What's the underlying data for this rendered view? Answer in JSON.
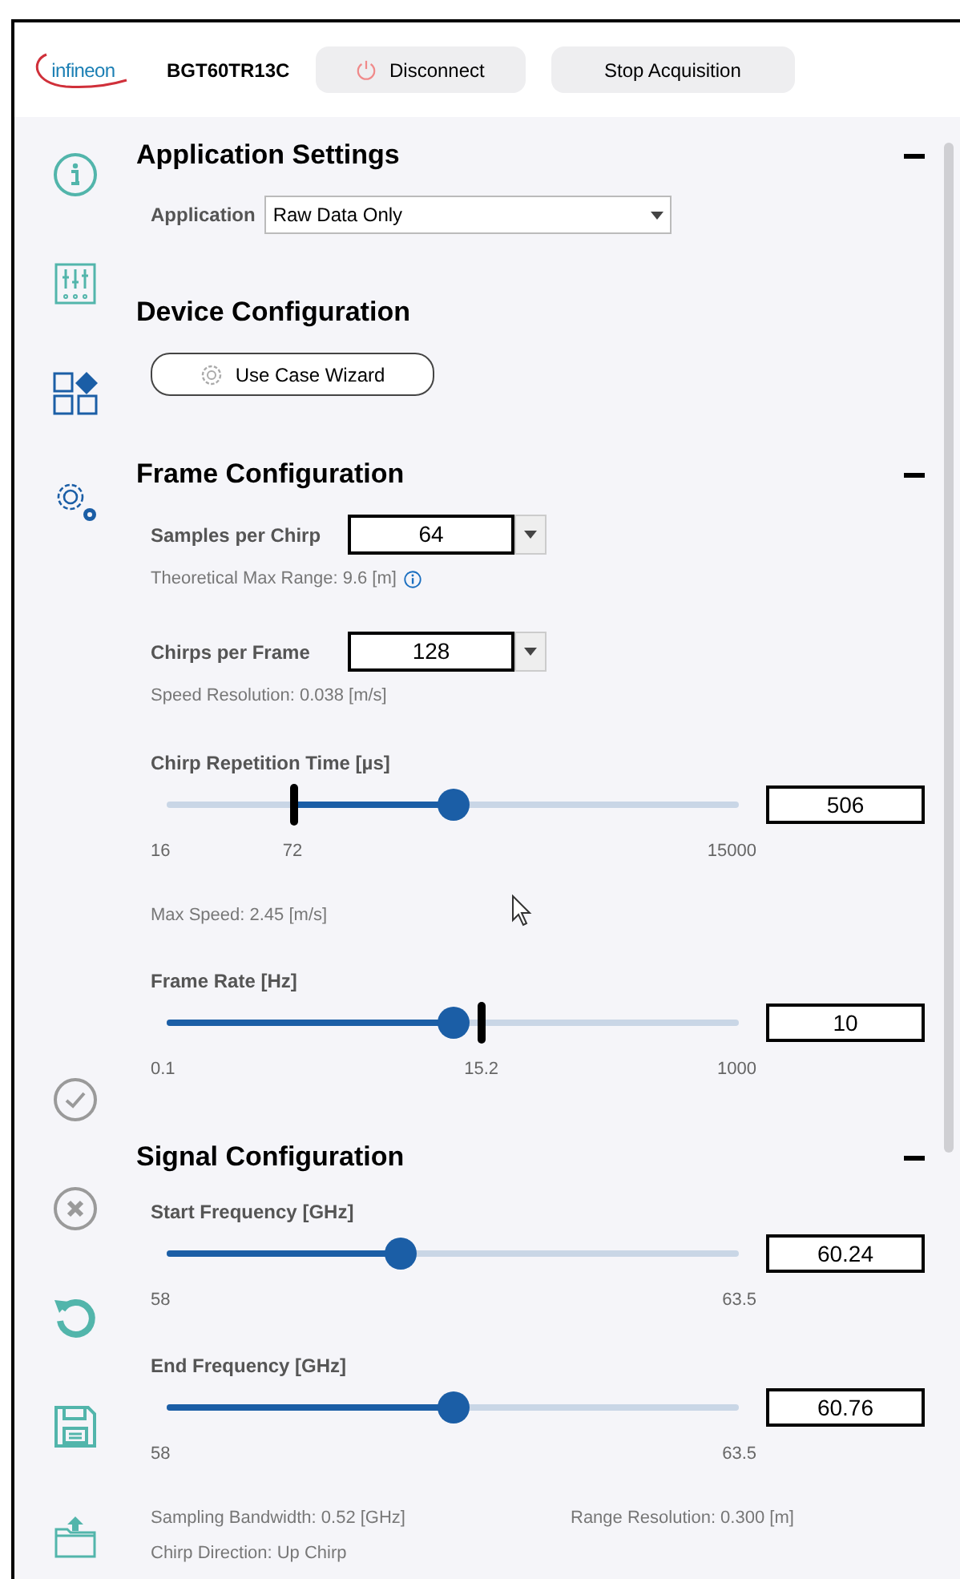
{
  "header": {
    "logo": "infineon",
    "device": "BGT60TR13C",
    "buttons": [
      {
        "kind": "power",
        "label": "Disconnect"
      },
      {
        "kind": "plain",
        "label": "Stop Acquisition"
      }
    ]
  },
  "sections": [
    {
      "title": "Application Settings",
      "collapsible": true,
      "items": [
        {
          "kind": "select",
          "label": "Application",
          "value": "Raw Data Only"
        }
      ]
    },
    {
      "title": "Device Configuration",
      "collapsible": false,
      "items": [
        {
          "kind": "button",
          "label": "Use Case Wizard"
        }
      ]
    },
    {
      "title": "Frame Configuration",
      "collapsible": true,
      "items": [
        {
          "kind": "spin",
          "label": "Samples per Chirp",
          "value": "64",
          "note": "Theoretical Max Range: 9.6 [m]",
          "info_icon": true
        },
        {
          "kind": "spin",
          "label": "Chirps per Frame",
          "value": "128",
          "note": "Speed Resolution: 0.038 [m/s]",
          "info_icon": false
        },
        {
          "kind": "slider",
          "label": "Chirp Repetition Time [µs]",
          "value": "506",
          "level": 0.5,
          "min": "16",
          "max": "15000",
          "marker": {
            "level": 0.22,
            "label": "72"
          }
        },
        {
          "kind": "note",
          "text": "Max Speed: 2.45 [m/s]"
        },
        {
          "kind": "slider",
          "label": "Frame Rate [Hz]",
          "value": "10",
          "level": 0.5,
          "min": "0.1",
          "max": "1000",
          "marker": {
            "level": 0.55,
            "label": "15.2"
          }
        }
      ]
    },
    {
      "title": "Signal Configuration",
      "collapsible": true,
      "items": [
        {
          "kind": "slider",
          "label": "Start Frequency [GHz]",
          "value": "60.24",
          "level": 0.41,
          "min": "58",
          "max": "63.5"
        },
        {
          "kind": "slider",
          "label": "End Frequency [GHz]",
          "value": "60.76",
          "level": 0.5,
          "min": "58",
          "max": "63.5"
        },
        {
          "kind": "info_grid",
          "texts": [
            "Sampling Bandwidth: 0.52 [GHz]",
            "Range Resolution: 0.300 [m]",
            "Chirp Direction: Up Chirp"
          ]
        }
      ]
    }
  ]
}
